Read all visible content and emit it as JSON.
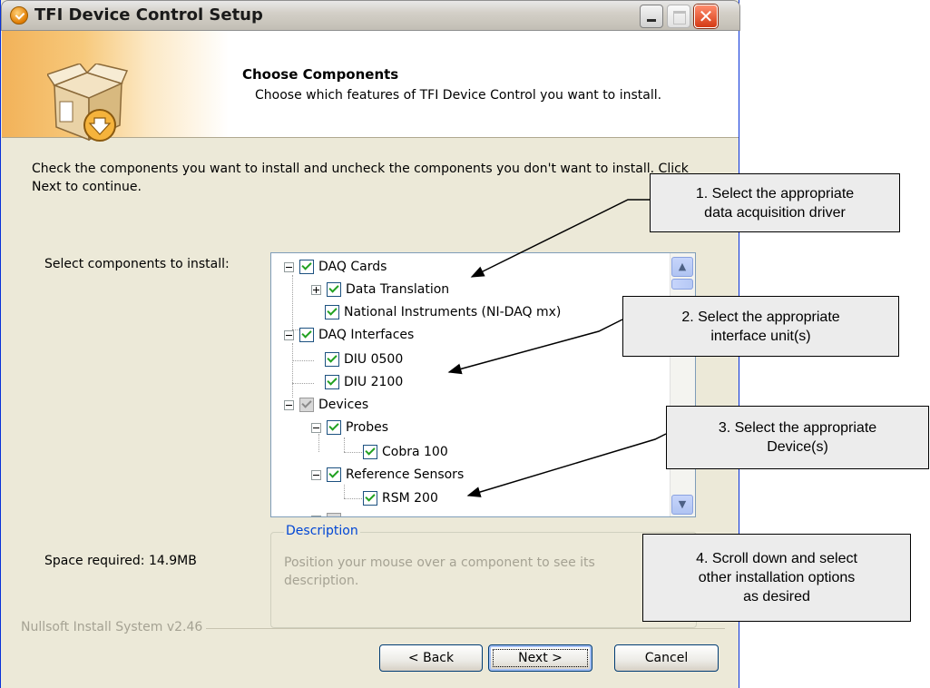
{
  "window": {
    "title": "TFI Device Control Setup",
    "close_glyph": "✕"
  },
  "header": {
    "title": "Choose Components",
    "subtitle": "Choose which features of TFI Device Control you want to install."
  },
  "body": {
    "instructions": "Check the components you want to install and uncheck the components you don't want to install. Click Next to continue.",
    "select_label": "Select components to install:",
    "space_required": "Space required: 14.9MB"
  },
  "tree": {
    "items": [
      {
        "label": "DAQ Cards",
        "checked": true
      },
      {
        "label": "Data Translation",
        "checked": true
      },
      {
        "label": "National Instruments (NI-DAQ mx)",
        "checked": true
      },
      {
        "label": "DAQ Interfaces",
        "checked": true
      },
      {
        "label": "DIU 0500",
        "checked": true
      },
      {
        "label": "DIU 2100",
        "checked": true
      },
      {
        "label": "Devices",
        "checked": "partial"
      },
      {
        "label": "Probes",
        "checked": true
      },
      {
        "label": "Cobra 100",
        "checked": true
      },
      {
        "label": "Reference Sensors",
        "checked": true
      },
      {
        "label": "RSM 200",
        "checked": true
      }
    ]
  },
  "scrollbar": {
    "up_glyph": "▲",
    "down_glyph": "▼"
  },
  "description": {
    "legend": "Description",
    "text": "Position your mouse over a component to see its description."
  },
  "footer": {
    "branding": "Nullsoft Install System v2.46",
    "back_label": "< Back",
    "next_label": "Next >",
    "cancel_label": "Cancel"
  },
  "callouts": [
    {
      "line1": "1.  Select the appropriate",
      "line2": "data acquisition driver"
    },
    {
      "line1": "2.  Select the appropriate",
      "line2": "interface unit(s)"
    },
    {
      "line1": "3.  Select the appropriate",
      "line2": "Device(s)"
    },
    {
      "line1": "4.  Scroll down and select",
      "line2": "other installation options",
      "line3": "as desired"
    }
  ],
  "colors": {
    "title_bar": "#d4d0c8",
    "dialog_bg": "#ece9d8",
    "checkbox_check": "#21a121",
    "link_blue": "#0046d5",
    "disabled_text": "#a5a293"
  }
}
